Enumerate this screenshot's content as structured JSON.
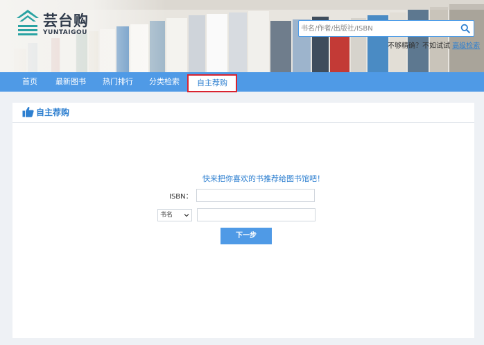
{
  "brand": {
    "name_cn": "芸台购",
    "name_en": "YUNTAIGOU"
  },
  "search": {
    "placeholder": "书名/作者/出版社/ISBN",
    "hint": "不够精确？不如试试",
    "advanced_link": "高级检索",
    "icon": "search-icon"
  },
  "nav": {
    "items": [
      {
        "label": "首页"
      },
      {
        "label": "最新图书"
      },
      {
        "label": "热门排行"
      },
      {
        "label": "分类检索"
      },
      {
        "label": "自主荐购",
        "active": true
      }
    ]
  },
  "panel": {
    "title": "自主荐购",
    "icon": "thumbs-up-icon"
  },
  "form": {
    "prompt": "快来把你喜欢的书推荐给图书馆吧！",
    "isbn_label": "ISBN：",
    "isbn_value": "",
    "type_selected": "书名",
    "type_value": "",
    "next_label": "下一步"
  },
  "colors": {
    "primary": "#4f9ae6",
    "accent_text": "#2d7fd0",
    "active_border": "#d9232f",
    "page_bg": "#eef1f5"
  }
}
